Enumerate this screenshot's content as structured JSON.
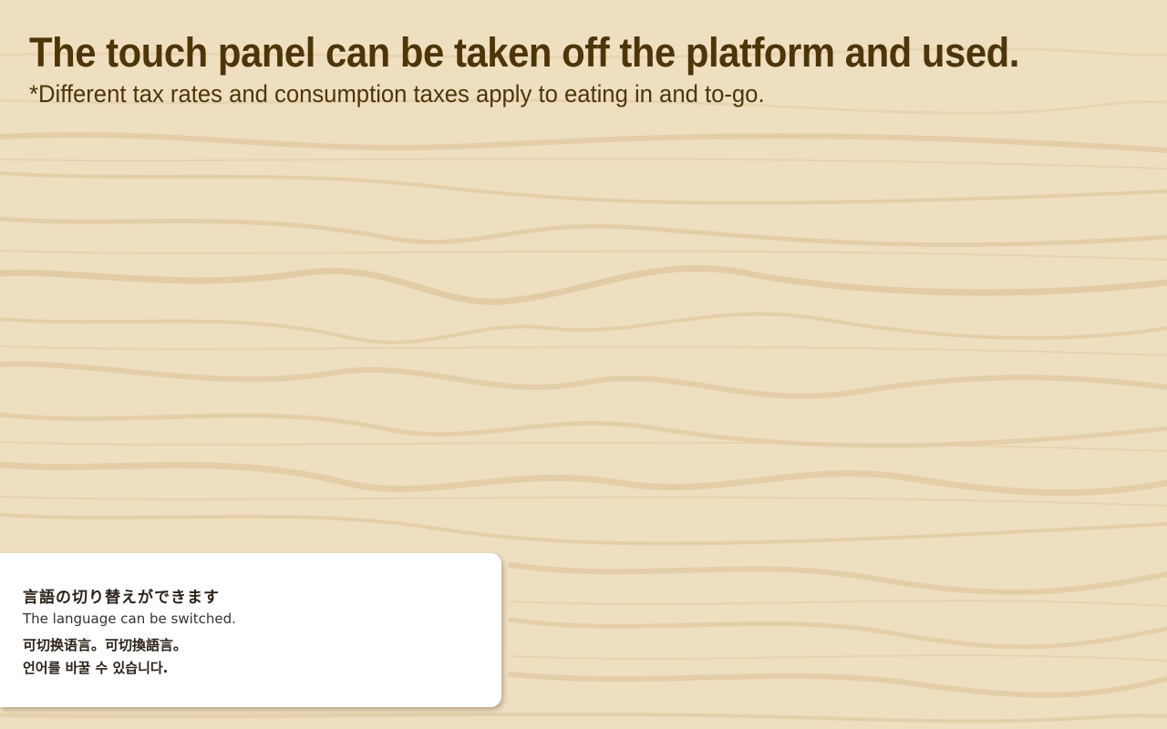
{
  "header": {
    "headline": "The touch panel can be taken off the platform and used.",
    "subline": "*Different tax rates and consumption taxes apply to eating in and to-go."
  },
  "language_card": {
    "japanese": "言語の切り替えができます",
    "english": "The language can be switched.",
    "chinese": "可切换语言。可切換語言。",
    "korean": "언어를 바꿀 수 있습니다."
  },
  "colors": {
    "wood_base": "#efdfc1",
    "wood_grain": "#d9bf92",
    "text_brown": "#4e3508",
    "card_bg": "#ffffff"
  }
}
